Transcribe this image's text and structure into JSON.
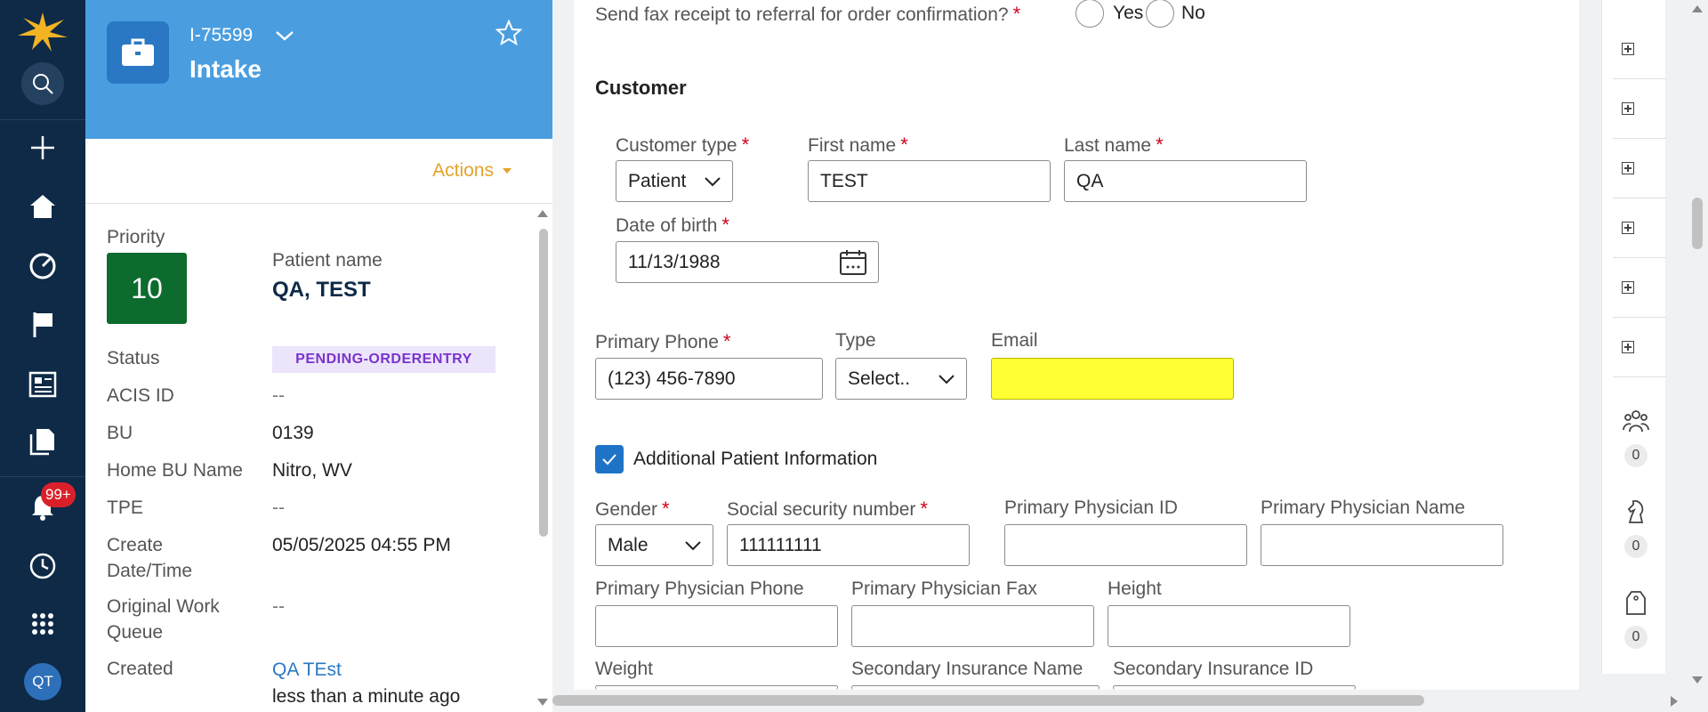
{
  "nav": {
    "badge_count": "99+",
    "user_initials": "QT",
    "icons": [
      "logo-icon",
      "search-icon",
      "add-icon",
      "home-icon",
      "dashboard-icon",
      "flag-icon",
      "news-icon",
      "documents-icon",
      "notifications-icon",
      "history-icon",
      "apps-icon"
    ]
  },
  "case": {
    "id": "I-75599",
    "title": "Intake",
    "actions_label": "Actions",
    "priority_label": "Priority",
    "priority_value": "10",
    "patient_name_label": "Patient name",
    "patient_name_value": "QA, TEST",
    "fields": [
      {
        "label": "Status",
        "value": "PENDING-ORDERENTRY"
      },
      {
        "label": "ACIS ID",
        "value": "--"
      },
      {
        "label": "BU",
        "value": "0139"
      },
      {
        "label": "Home BU Name",
        "value": "Nitro, WV"
      },
      {
        "label": "TPE",
        "value": "--"
      },
      {
        "label": "Create Date/Time",
        "value": "05/05/2025 04:55 PM"
      },
      {
        "label": "Original Work Queue",
        "value": "--"
      },
      {
        "label": "Created",
        "value": "QA TEst",
        "sub": "less than a minute ago"
      }
    ],
    "field_labels_wrapped": {
      "create_1": "Create",
      "create_2": "Date/Time",
      "owq_1": "Original Work",
      "owq_2": "Queue"
    }
  },
  "form": {
    "fax_question": "Send fax receipt to referral for order confirmation?",
    "fax_yes": "Yes",
    "fax_no": "No",
    "customer_section": "Customer",
    "customer_type_label": "Customer type",
    "customer_type_value": "Patient",
    "first_name_label": "First name",
    "first_name_value": "TEST",
    "last_name_label": "Last name",
    "last_name_value": "QA",
    "dob_label": "Date of birth",
    "dob_value": "11/13/1988",
    "primary_phone_label": "Primary Phone",
    "primary_phone_value": "(123) 456-7890",
    "type_label": "Type",
    "type_value": "Select..",
    "email_label": "Email",
    "email_value": "",
    "additional_info_label": "Additional Patient Information",
    "additional_info_checked": true,
    "gender_label": "Gender",
    "gender_value": "Male",
    "ssn_label": "Social security number",
    "ssn_value": "111111111",
    "pp_id_label": "Primary Physician ID",
    "pp_id_value": "",
    "pp_name_label": "Primary Physician Name",
    "pp_name_value": "",
    "pp_phone_label": "Primary Physician Phone",
    "pp_phone_value": "",
    "pp_fax_label": "Primary Physician Fax",
    "pp_fax_value": "",
    "height_label": "Height",
    "height_value": "",
    "weight_label": "Weight",
    "sec_ins_name_label": "Secondary Insurance Name",
    "sec_ins_id_label": "Secondary Insurance ID",
    "required_mark": "*"
  },
  "utility": {
    "counts": [
      "0",
      "0",
      "0"
    ],
    "icons": [
      "team-icon",
      "chess-knight-icon",
      "tag-icon"
    ]
  },
  "colors": {
    "nav_bg": "#0e2a47",
    "header_bg": "#4a9ee0",
    "priority_bg": "#0d6b2e",
    "status_text": "#7a33cc",
    "actions": "#e3a32b",
    "required": "#d0021b",
    "email_highlight": "#ffff33",
    "checkbox": "#1f73c7"
  }
}
